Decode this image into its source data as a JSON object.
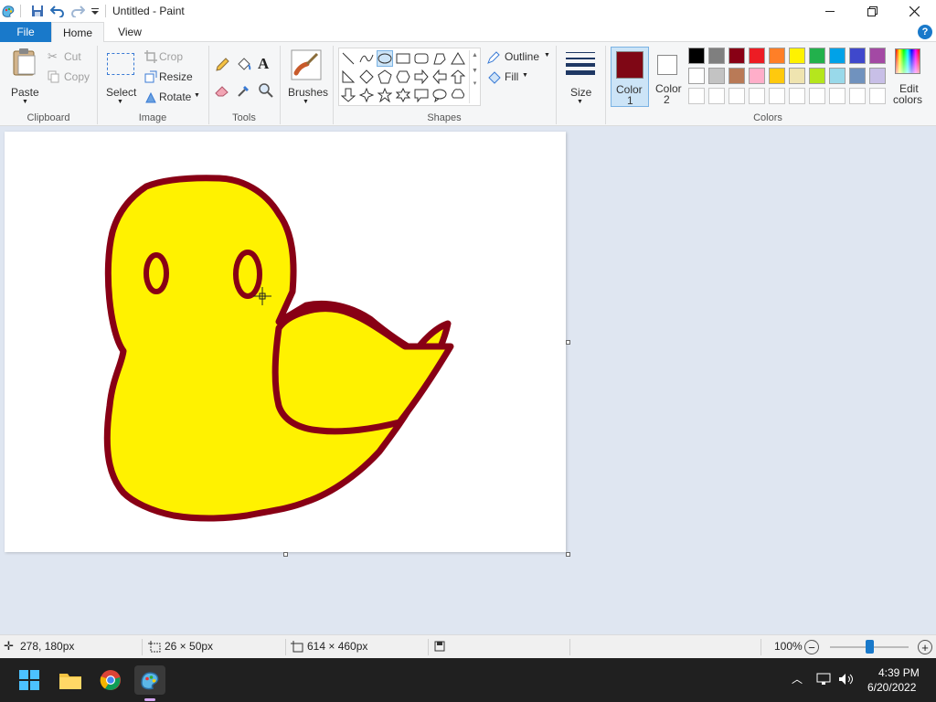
{
  "window": {
    "title": "Untitled - Paint"
  },
  "tabs": {
    "file": "File",
    "home": "Home",
    "view": "View",
    "help": "?"
  },
  "clipboard": {
    "paste": "Paste",
    "cut": "Cut",
    "copy": "Copy",
    "group": "Clipboard"
  },
  "image": {
    "select": "Select",
    "crop": "Crop",
    "resize": "Resize",
    "rotate": "Rotate",
    "group": "Image"
  },
  "tools": {
    "group": "Tools",
    "text_glyph": "A"
  },
  "brushes": {
    "label": "Brushes"
  },
  "shapes": {
    "outline": "Outline",
    "fill": "Fill",
    "group": "Shapes"
  },
  "size": {
    "label": "Size"
  },
  "color1": {
    "line1": "Color",
    "line2": "1",
    "value": "#7f0715"
  },
  "color2": {
    "line1": "Color",
    "line2": "2",
    "value": "#ffffff"
  },
  "colors": {
    "group": "Colors",
    "edit_line1": "Edit",
    "edit_line2": "colors",
    "row1": [
      "#000000",
      "#7f7f7f",
      "#880015",
      "#ed1c24",
      "#ff7f27",
      "#fff200",
      "#22b14c",
      "#00a2e8",
      "#3f48cc",
      "#a349a4"
    ],
    "row2": [
      "#ffffff",
      "#c3c3c3",
      "#b97a57",
      "#ffaec9",
      "#ffc90e",
      "#efe4b0",
      "#b5e61d",
      "#99d9ea",
      "#7092be",
      "#c8bfe7"
    ],
    "row3": [
      "#ffffff",
      "#ffffff",
      "#ffffff",
      "#ffffff",
      "#ffffff",
      "#ffffff",
      "#ffffff",
      "#ffffff",
      "#ffffff",
      "#ffffff"
    ]
  },
  "drawing": {
    "fill_color": "#fff200",
    "outline_color": "#880015"
  },
  "status": {
    "cursor_pos": "278, 180px",
    "selection_size": "26 × 50px",
    "canvas_size": "614 × 460px",
    "zoom": "100%",
    "zoom_fraction": 0.5
  },
  "taskbar": {
    "time": "4:39 PM",
    "date": "6/20/2022"
  }
}
